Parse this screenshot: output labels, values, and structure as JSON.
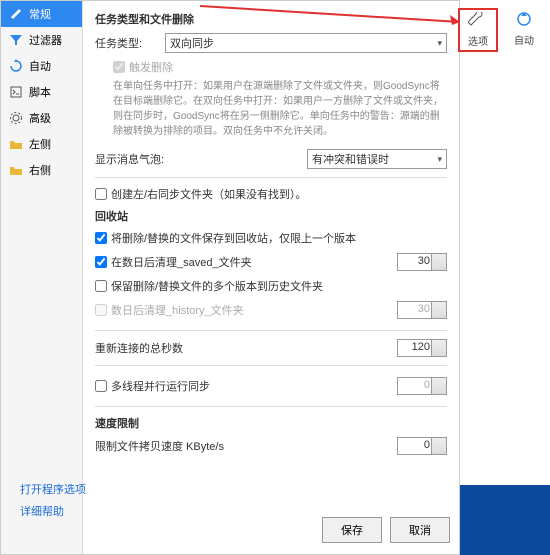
{
  "toolbar": {
    "options_label": "选项",
    "auto_label": "自动"
  },
  "sidebar": {
    "items": [
      {
        "label": "常规"
      },
      {
        "label": "过滤器"
      },
      {
        "label": "自动"
      },
      {
        "label": "脚本"
      },
      {
        "label": "高级"
      },
      {
        "label": "左侧"
      },
      {
        "label": "右侧"
      }
    ]
  },
  "main": {
    "section1_title": "任务类型和文件删除",
    "task_type_label": "任务类型:",
    "task_type_value": "双向同步",
    "trigger_delete_label": "触发删除",
    "help_text": "在单向任务中打开：如果用户在源端删除了文件或文件夹，则GoodSync将在目标端删除它。在双向任务中打开：如果用户一方删除了文件或文件夹，则在同步时，GoodSync将在另一侧删除它。单向任务中的警告：源端的删除被转换为排除的项目。双向任务中不允许关闭。",
    "show_balloon_label": "显示消息气泡:",
    "show_balloon_value": "有冲突和错误时",
    "create_folders_label": "创建左/右同步文件夹（如果没有找到）。",
    "recycle_title": "回收站",
    "save_recycle_label": "将删除/替换的文件保存到回收站，仅限上一个版本",
    "cleanup_saved_label": "在数日后清理_saved_文件夹",
    "cleanup_saved_value": "30",
    "keep_history_label": "保留删除/替换文件的多个版本到历史文件夹",
    "cleanup_history_label": "数日后清理_history_文件夹",
    "cleanup_history_value": "30",
    "reconnect_label": "重新连接的总秒数",
    "reconnect_value": "120",
    "multithread_label": "多线程并行运行同步",
    "multithread_value": "0",
    "speed_title": "速度限制",
    "speed_limit_label": "限制文件拷贝速度 KByte/s",
    "speed_limit_value": "0"
  },
  "footer": {
    "save": "保存",
    "cancel": "取消"
  },
  "links": {
    "open_opts": "打开程序选项",
    "help": "详细帮助"
  }
}
